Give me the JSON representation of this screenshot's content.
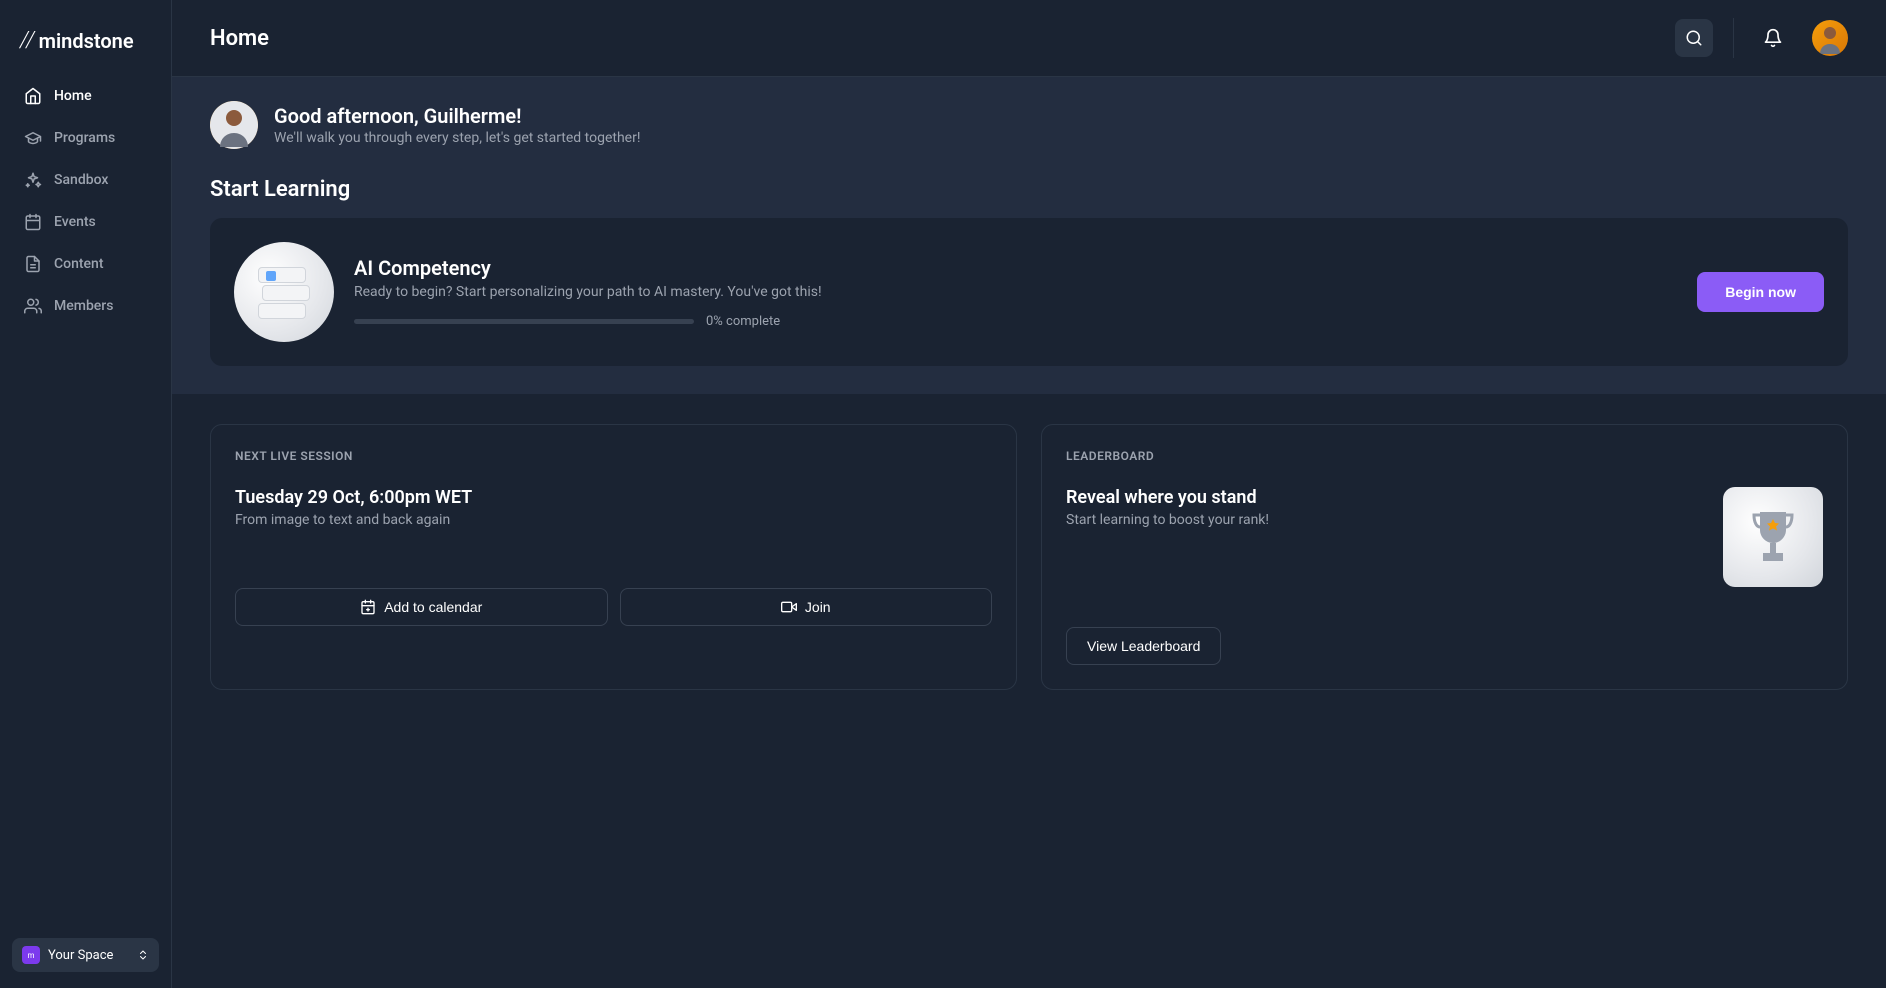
{
  "app": {
    "logo": "mindstone",
    "pageTitle": "Home"
  },
  "sidebar": {
    "items": [
      {
        "label": "Home",
        "active": true
      },
      {
        "label": "Programs",
        "active": false
      },
      {
        "label": "Sandbox",
        "active": false
      },
      {
        "label": "Events",
        "active": false
      },
      {
        "label": "Content",
        "active": false
      },
      {
        "label": "Members",
        "active": false
      }
    ],
    "spaceSelector": {
      "label": "Your Space",
      "icon": "m"
    }
  },
  "greeting": {
    "title": "Good afternoon, Guilherme!",
    "subtitle": "We'll walk you through every step, let's get started together!"
  },
  "startLearning": {
    "sectionTitle": "Start Learning",
    "card": {
      "title": "AI Competency",
      "description": "Ready to begin? Start personalizing your path to AI mastery. You've got this!",
      "progress": {
        "percent": 0,
        "text": "0% complete"
      },
      "buttonLabel": "Begin now"
    }
  },
  "nextSession": {
    "label": "NEXT LIVE SESSION",
    "title": "Tuesday 29 Oct, 6:00pm WET",
    "subtitle": "From image to text and back again",
    "addCalendarLabel": "Add to calendar",
    "joinLabel": "Join"
  },
  "leaderboard": {
    "label": "LEADERBOARD",
    "title": "Reveal where you stand",
    "subtitle": "Start learning to boost your rank!",
    "buttonLabel": "View Leaderboard"
  }
}
